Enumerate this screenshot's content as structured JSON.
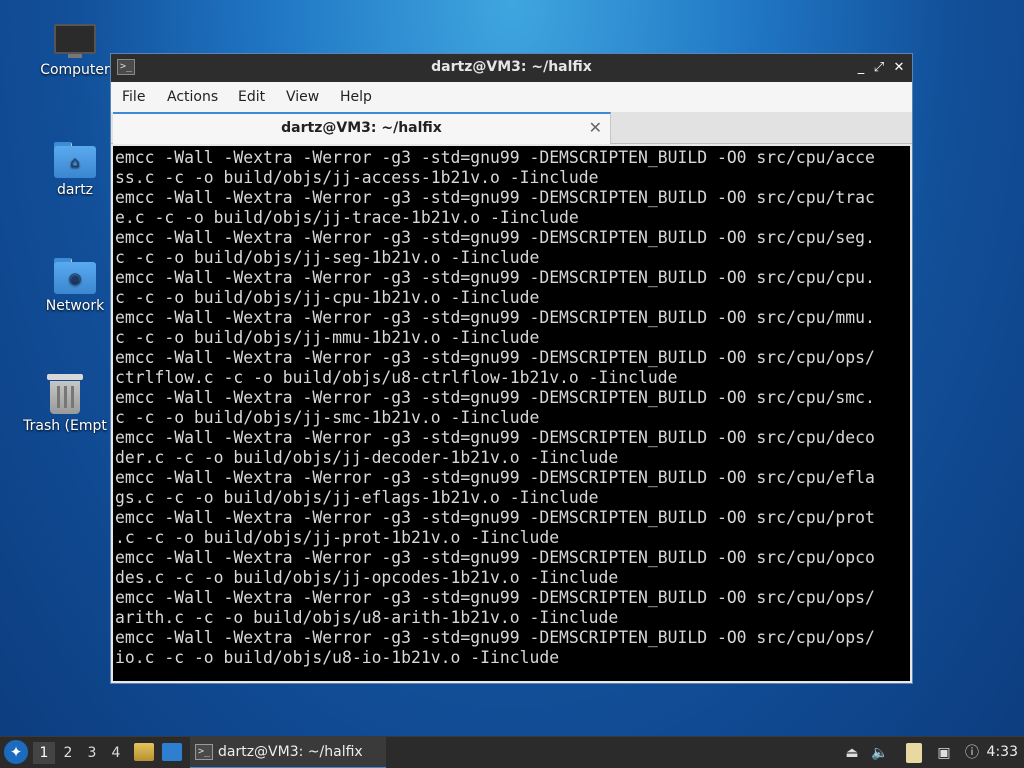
{
  "desktop": {
    "icons": [
      {
        "label": "Computer"
      },
      {
        "label": "dartz"
      },
      {
        "label": "Network"
      },
      {
        "label": "Trash (Empt"
      }
    ]
  },
  "window": {
    "title": "dartz@VM3: ~/halfix",
    "controls": {
      "minimize": "_",
      "maximize": "⤢",
      "close": "✕"
    },
    "menu": [
      "File",
      "Actions",
      "Edit",
      "View",
      "Help"
    ],
    "tab": {
      "label": "dartz@VM3: ~/halfix",
      "close": "✕"
    }
  },
  "terminal": {
    "lines": [
      "emcc -Wall -Wextra -Werror -g3 -std=gnu99 -DEMSCRIPTEN_BUILD -O0 src/cpu/acce",
      "ss.c -c -o build/objs/jj-access-1b21v.o -Iinclude",
      "emcc -Wall -Wextra -Werror -g3 -std=gnu99 -DEMSCRIPTEN_BUILD -O0 src/cpu/trac",
      "e.c -c -o build/objs/jj-trace-1b21v.o -Iinclude",
      "emcc -Wall -Wextra -Werror -g3 -std=gnu99 -DEMSCRIPTEN_BUILD -O0 src/cpu/seg.",
      "c -c -o build/objs/jj-seg-1b21v.o -Iinclude",
      "emcc -Wall -Wextra -Werror -g3 -std=gnu99 -DEMSCRIPTEN_BUILD -O0 src/cpu/cpu.",
      "c -c -o build/objs/jj-cpu-1b21v.o -Iinclude",
      "emcc -Wall -Wextra -Werror -g3 -std=gnu99 -DEMSCRIPTEN_BUILD -O0 src/cpu/mmu.",
      "c -c -o build/objs/jj-mmu-1b21v.o -Iinclude",
      "emcc -Wall -Wextra -Werror -g3 -std=gnu99 -DEMSCRIPTEN_BUILD -O0 src/cpu/ops/",
      "ctrlflow.c -c -o build/objs/u8-ctrlflow-1b21v.o -Iinclude",
      "emcc -Wall -Wextra -Werror -g3 -std=gnu99 -DEMSCRIPTEN_BUILD -O0 src/cpu/smc.",
      "c -c -o build/objs/jj-smc-1b21v.o -Iinclude",
      "emcc -Wall -Wextra -Werror -g3 -std=gnu99 -DEMSCRIPTEN_BUILD -O0 src/cpu/deco",
      "der.c -c -o build/objs/jj-decoder-1b21v.o -Iinclude",
      "emcc -Wall -Wextra -Werror -g3 -std=gnu99 -DEMSCRIPTEN_BUILD -O0 src/cpu/efla",
      "gs.c -c -o build/objs/jj-eflags-1b21v.o -Iinclude",
      "emcc -Wall -Wextra -Werror -g3 -std=gnu99 -DEMSCRIPTEN_BUILD -O0 src/cpu/prot",
      ".c -c -o build/objs/jj-prot-1b21v.o -Iinclude",
      "emcc -Wall -Wextra -Werror -g3 -std=gnu99 -DEMSCRIPTEN_BUILD -O0 src/cpu/opco",
      "des.c -c -o build/objs/jj-opcodes-1b21v.o -Iinclude",
      "emcc -Wall -Wextra -Werror -g3 -std=gnu99 -DEMSCRIPTEN_BUILD -O0 src/cpu/ops/",
      "arith.c -c -o build/objs/u8-arith-1b21v.o -Iinclude",
      "emcc -Wall -Wextra -Werror -g3 -std=gnu99 -DEMSCRIPTEN_BUILD -O0 src/cpu/ops/",
      "io.c -c -o build/objs/u8-io-1b21v.o -Iinclude"
    ]
  },
  "taskbar": {
    "workspaces": [
      "1",
      "2",
      "3",
      "4"
    ],
    "active_workspace": "1",
    "task_label": "dartz@VM3: ~/halfix",
    "tray_icons": [
      "eject-icon",
      "volume-icon",
      "clipboard-icon",
      "network-icon",
      "notification-icon"
    ],
    "clock": "4:33"
  },
  "colors": {
    "accent": "#3c8ad8",
    "terminal_bg": "#000000",
    "terminal_fg": "#d8d8d8",
    "titlebar_bg": "#2d2d2d",
    "taskbar_bg": "#2b2b2b"
  }
}
